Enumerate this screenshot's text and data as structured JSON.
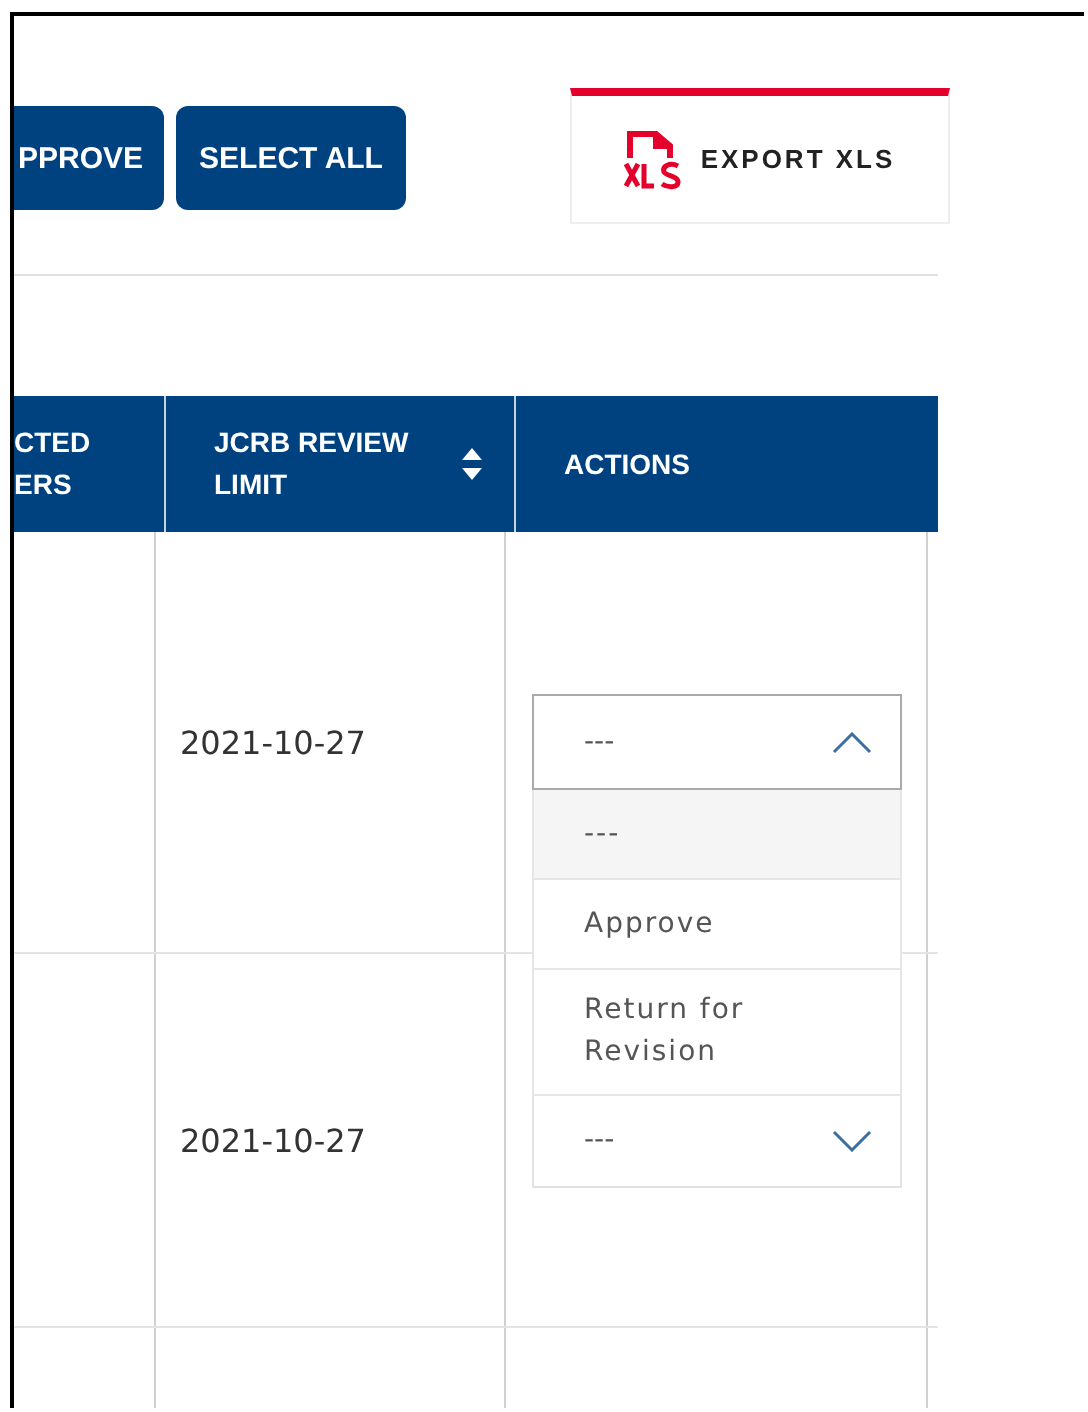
{
  "toolbar": {
    "buttons": [
      {
        "label": "PPROVE"
      },
      {
        "label": "SELECT ALL"
      }
    ],
    "export": {
      "label": "EXPORT XLS"
    }
  },
  "table": {
    "columns": [
      {
        "label": "CTED\nERS",
        "sortable": false
      },
      {
        "label": "JCRB REVIEW\nLIMIT",
        "sortable": true
      },
      {
        "label": "ACTIONS",
        "sortable": false
      }
    ],
    "rows": [
      {
        "review_limit": "2021-10-27",
        "action": {
          "value": "---",
          "expanded": true,
          "options": [
            {
              "label": "---",
              "selected": true
            },
            {
              "label": "Approve",
              "selected": false
            },
            {
              "label": "Return for Revision",
              "selected": false
            }
          ]
        }
      },
      {
        "review_limit": "2021-10-27",
        "action": {
          "value": "---",
          "expanded": false
        }
      }
    ]
  }
}
